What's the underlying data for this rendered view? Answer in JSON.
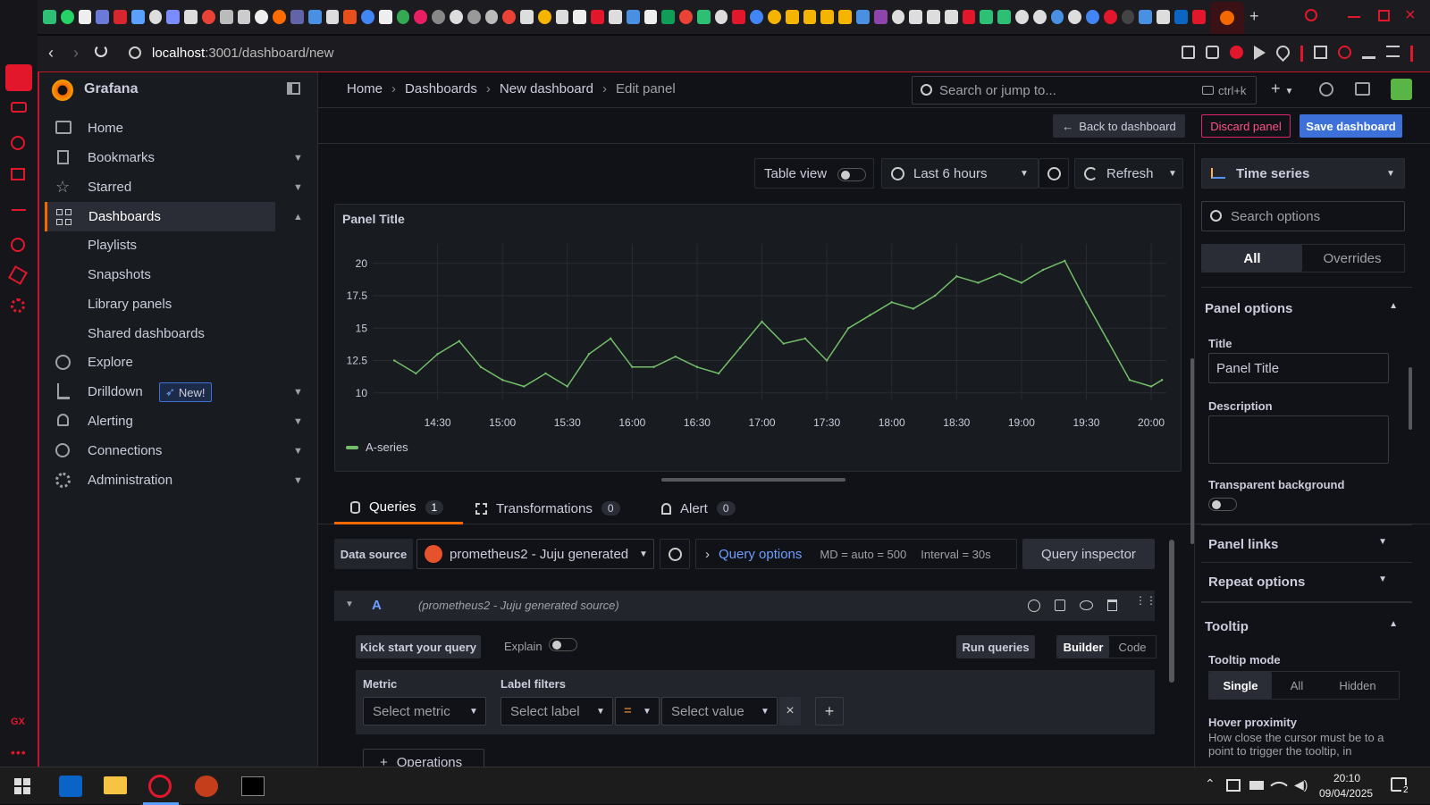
{
  "browser": {
    "url_host": "localhost",
    "url_rest": ":3001/dashboard/new",
    "tray_time": "20:10",
    "tray_date": "09/04/2025",
    "notif_count": "2",
    "gx_label": "GX"
  },
  "grafana": {
    "app_name": "Grafana",
    "breadcrumbs": [
      "Home",
      "Dashboards",
      "New dashboard",
      "Edit panel"
    ],
    "search_placeholder": "Search or jump to...",
    "search_shortcut": "ctrl+k",
    "nav": [
      {
        "label": "Home"
      },
      {
        "label": "Bookmarks"
      },
      {
        "label": "Starred"
      },
      {
        "label": "Dashboards"
      },
      {
        "label": "Explore"
      },
      {
        "label": "Drilldown",
        "badge": "New!"
      },
      {
        "label": "Alerting"
      },
      {
        "label": "Connections"
      },
      {
        "label": "Administration"
      }
    ],
    "dash_sub": [
      "Playlists",
      "Snapshots",
      "Library panels",
      "Shared dashboards"
    ],
    "toolbar": {
      "back": "Back to dashboard",
      "discard": "Discard panel",
      "save": "Save dashboard",
      "table_view": "Table view",
      "time_range": "Last 6 hours",
      "refresh": "Refresh"
    },
    "panel": {
      "title": "Panel Title"
    },
    "tabs": [
      {
        "label": "Queries",
        "count": "1"
      },
      {
        "label": "Transformations",
        "count": "0"
      },
      {
        "label": "Alert",
        "count": "0"
      }
    ],
    "query": {
      "ds_label": "Data source",
      "ds_value": "prometheus2 - Juju generated",
      "options_label": "Query options",
      "md": "MD = auto = 500",
      "interval": "Interval = 30s",
      "inspector": "Query inspector",
      "ref_id": "A",
      "ref_ds": "(prometheus2 - Juju generated source)",
      "kick": "Kick start your query",
      "explain": "Explain",
      "run": "Run queries",
      "builder": "Builder",
      "code": "Code",
      "metric_label": "Metric",
      "metric_placeholder": "Select metric",
      "label_filters": "Label filters",
      "select_label": "Select label",
      "op": "=",
      "select_value": "Select value",
      "operations": "Operations"
    },
    "options_pane": {
      "viz": "Time series",
      "search": "Search options",
      "all": "All",
      "overrides": "Overrides",
      "panel_options": "Panel options",
      "title_label": "Title",
      "title_value": "Panel Title",
      "desc_label": "Description",
      "transparent": "Transparent background",
      "panel_links": "Panel links",
      "repeat": "Repeat options",
      "tooltip": "Tooltip",
      "tooltip_mode": "Tooltip mode",
      "mode_single": "Single",
      "mode_all": "All",
      "mode_hidden": "Hidden",
      "hover": "Hover proximity",
      "hover_desc": "How close the cursor must be to a point to trigger the tooltip, in"
    }
  },
  "chart_data": {
    "type": "line",
    "title": "Panel Title",
    "x_ticks": [
      "14:30",
      "15:00",
      "15:30",
      "16:00",
      "16:30",
      "17:00",
      "17:30",
      "18:00",
      "18:30",
      "19:00",
      "19:30",
      "20:00"
    ],
    "y_ticks": [
      "10",
      "12.5",
      "15",
      "17.5",
      "20"
    ],
    "ylim": [
      9.5,
      21.5
    ],
    "grid": true,
    "legend_position": "bottom-left",
    "series": [
      {
        "name": "A-series",
        "color": "#73bf69",
        "x": [
          "14:10",
          "14:20",
          "14:30",
          "14:40",
          "14:50",
          "15:00",
          "15:10",
          "15:20",
          "15:30",
          "15:40",
          "15:50",
          "16:00",
          "16:10",
          "16:20",
          "16:30",
          "16:40",
          "16:50",
          "17:00",
          "17:10",
          "17:20",
          "17:30",
          "17:40",
          "17:50",
          "18:00",
          "18:10",
          "18:20",
          "18:30",
          "18:40",
          "18:50",
          "19:00",
          "19:10",
          "19:20",
          "19:30",
          "19:40",
          "19:50",
          "20:00",
          "20:05"
        ],
        "y": [
          12.5,
          11.5,
          13,
          14,
          12,
          11,
          10.5,
          11.5,
          10.5,
          13,
          14.2,
          12,
          12,
          12.8,
          12,
          11.5,
          13.5,
          15.5,
          13.8,
          14.2,
          12.5,
          15,
          16,
          17,
          16.5,
          17.5,
          19,
          18.5,
          19.2,
          18.5,
          19.5,
          20.2,
          17,
          14,
          11,
          10.5,
          11
        ]
      }
    ]
  }
}
